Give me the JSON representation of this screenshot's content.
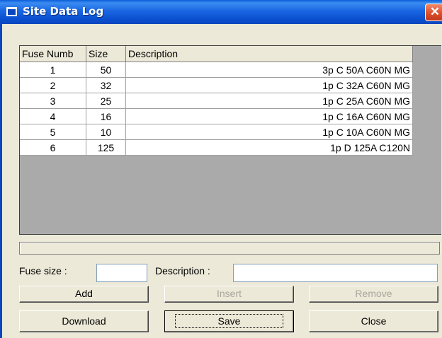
{
  "window": {
    "title": "Site Data Log",
    "close_glyph": "✕"
  },
  "grid": {
    "columns": [
      "Fuse Numb",
      "Size",
      "Description"
    ],
    "rows": [
      {
        "fuse": "1",
        "size": "50",
        "description": "3p C 50A C60N MG"
      },
      {
        "fuse": "2",
        "size": "32",
        "description": "1p C 32A C60N MG"
      },
      {
        "fuse": "3",
        "size": "25",
        "description": "1p C 25A C60N MG"
      },
      {
        "fuse": "4",
        "size": "16",
        "description": "1p C 16A C60N MG"
      },
      {
        "fuse": "5",
        "size": "10",
        "description": "1p C 10A C60N MG"
      },
      {
        "fuse": "6",
        "size": "125",
        "description": "1p D 125A C120N"
      }
    ]
  },
  "form": {
    "fuse_size_label": "Fuse size :",
    "fuse_size_value": "",
    "description_label": "Description :",
    "description_value": ""
  },
  "buttons": {
    "add": "Add",
    "insert": "Insert",
    "remove": "Remove",
    "download": "Download",
    "save": "Save",
    "close": "Close"
  },
  "colors": {
    "titlebar": "#0a4fcf",
    "window_bg": "#ece9d8",
    "grid_bg": "#aaaaaa",
    "disabled_text": "#a7a69c"
  }
}
